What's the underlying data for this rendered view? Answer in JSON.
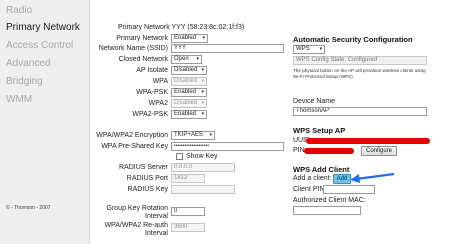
{
  "sidebar": {
    "items": [
      {
        "label": "Radio",
        "active": false
      },
      {
        "label": "Primary Network",
        "active": true
      },
      {
        "label": "Access Control",
        "active": false
      },
      {
        "label": "Advanced",
        "active": false
      },
      {
        "label": "Bridging",
        "active": false
      },
      {
        "label": "WMM",
        "active": false
      }
    ],
    "copyright": "© - Thomson - 2007"
  },
  "form": {
    "network_title": "Primary Network YYY (58:23:8c:02:1f:f3)",
    "primary_network": {
      "label": "Primary Network",
      "value": "Enabled"
    },
    "ssid": {
      "label": "Network Name (SSID)",
      "value": "YYY"
    },
    "closed_network": {
      "label": "Closed Network",
      "value": "Open"
    },
    "ap_isolate": {
      "label": "AP Isolate",
      "value": "Disabled"
    },
    "wpa": {
      "label": "WPA",
      "value": "Disabled"
    },
    "wpa_psk": {
      "label": "WPA-PSK",
      "value": "Enabled"
    },
    "wpa2": {
      "label": "WPA2",
      "value": "Disabled"
    },
    "wpa2_psk": {
      "label": "WPA2-PSK",
      "value": "Enabled"
    },
    "encryption": {
      "label": "WPA/WPA2 Encryption",
      "value": "TKIP+AES"
    },
    "psk": {
      "label": "WPA Pre-Shared Key",
      "value": "••••••••••••••••••••"
    },
    "show_key": {
      "label": "Show Key"
    },
    "radius_server": {
      "label": "RADIUS Server",
      "value": "0.0.0.0"
    },
    "radius_port": {
      "label": "RADIUS Port",
      "value": "1812"
    },
    "radius_key": {
      "label": "RADIUS Key",
      "value": ""
    },
    "group_key_rotation": {
      "label_line1": "Group Key Rotation",
      "label_line2": "Interval",
      "value": "0"
    },
    "reauth": {
      "label_line1": "WPA/WPA2 Re-auth",
      "label_line2": "Interval",
      "value": "3600"
    }
  },
  "auto_security": {
    "title": "Automatic Security Configuration",
    "mode": "WPS",
    "state": "WPS Config State: Configured",
    "note": "The physical button on the AP will provision wireless clients using Wi-Fi Protected Setup (WPS)",
    "device_name_label": "Device Name",
    "device_name": "ThomsonAP"
  },
  "wps_setup": {
    "title": "WPS Setup AP",
    "uuid_label": "UUID:",
    "pin_label": "PIN:",
    "configure_button": "Configure"
  },
  "wps_client": {
    "title": "WPS Add Client",
    "add_label": "Add a client:",
    "add_button": "Add",
    "client_pin_label": "Client PIN:",
    "mac_label": "Authorized Client MAC:"
  },
  "colors": {
    "accent": "#6ec3ea",
    "redaction": "#e60000",
    "arrow": "#1e6fe0"
  }
}
